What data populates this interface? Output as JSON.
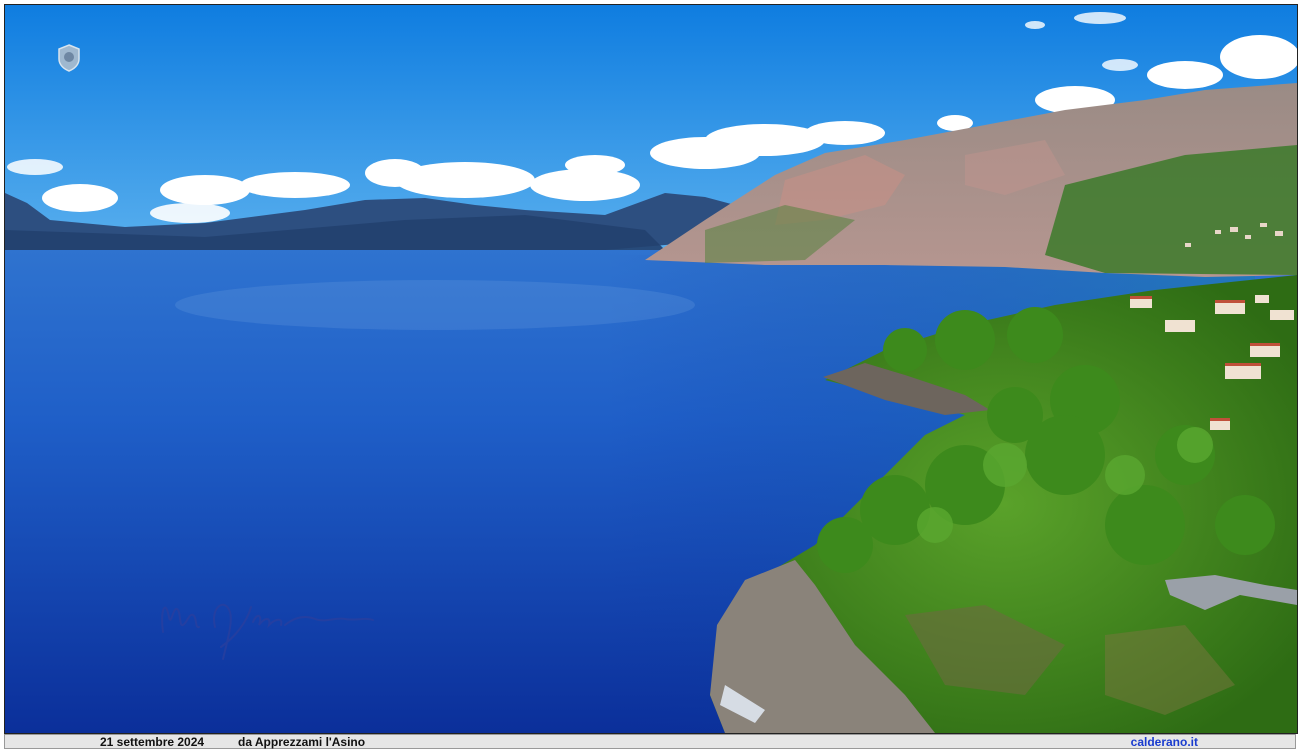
{
  "caption": {
    "date": "21 settembre 2024",
    "title": "da Apprezzami l'Asino",
    "site": "calderano.it"
  },
  "watermark": {
    "signature_text": "Mimmo Calderano"
  },
  "colors": {
    "sky_top": "#0f7de0",
    "sky_bottom": "#5ab0ee",
    "sea_deep": "#0b2f9a",
    "sea_mid": "#1f5fc8",
    "sea_shallow": "#1a7fa8",
    "cliff": "#a88f8a",
    "vegetation": "#3f8a1f",
    "caption_bg": "#e6e6e6",
    "site_link": "#1a3ccf"
  }
}
